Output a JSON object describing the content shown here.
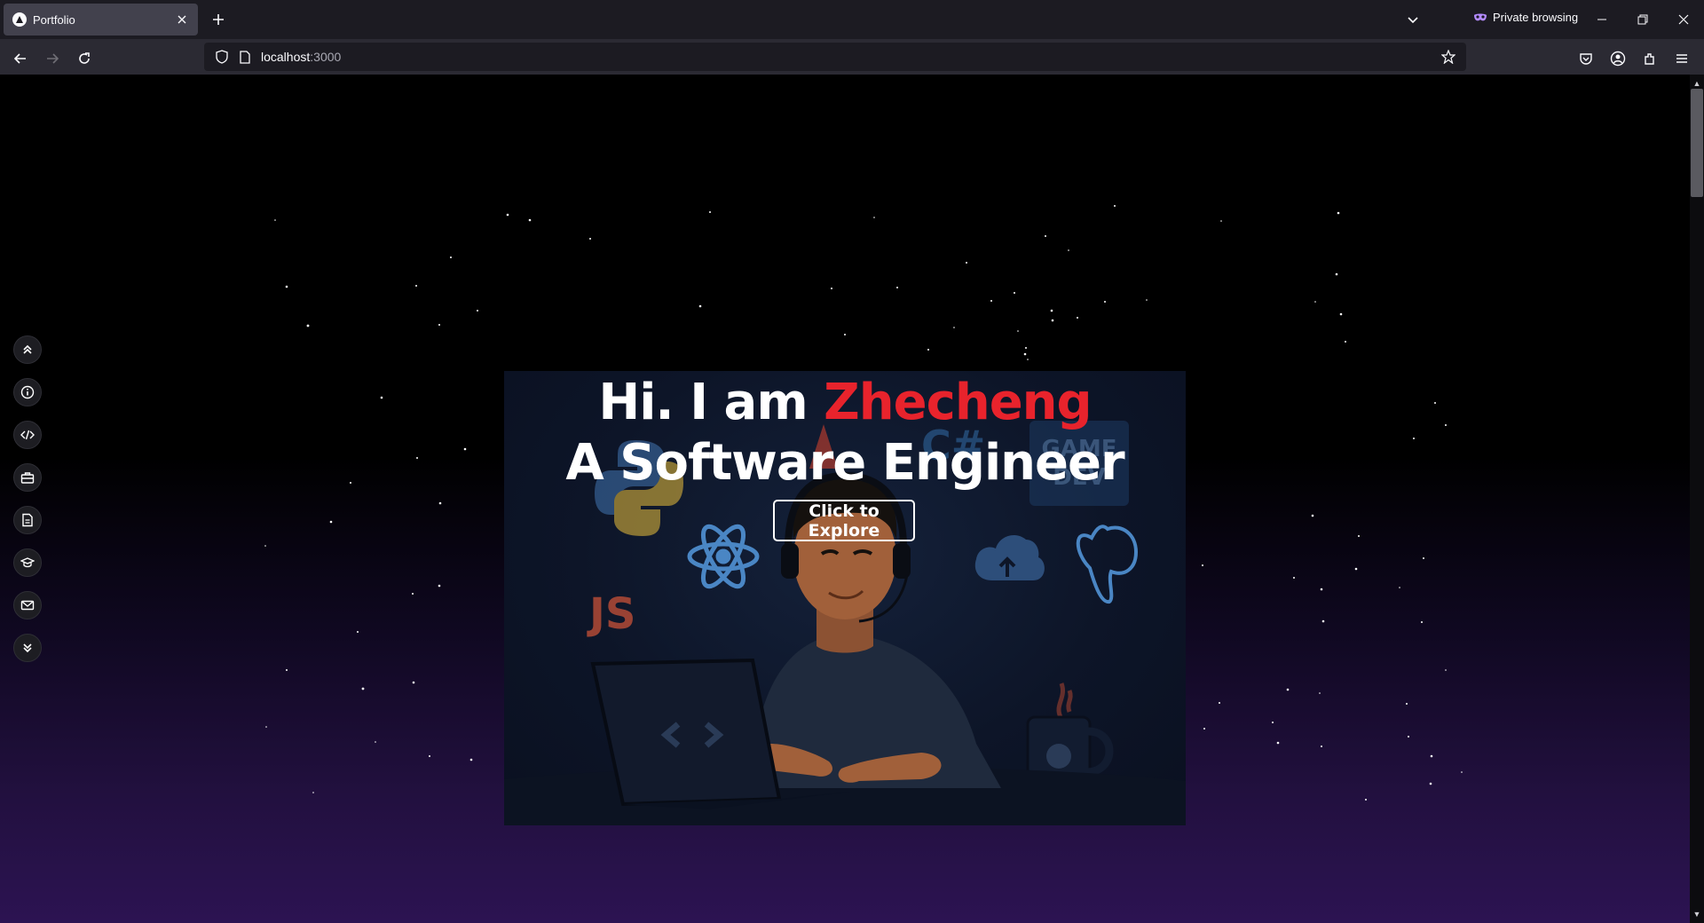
{
  "browser": {
    "tab_title": "Portfolio",
    "private_label": "Private browsing",
    "url_host": "localhost",
    "url_port": ":3000",
    "icons": [
      "favicon-icon",
      "close-icon",
      "plus-icon",
      "chevron-down-icon",
      "private-mask-icon",
      "minimize-icon",
      "restore-icon",
      "close-window-icon",
      "back-icon",
      "forward-icon",
      "reload-icon",
      "shield-icon",
      "page-icon",
      "star-icon",
      "pocket-icon",
      "account-icon",
      "extensions-icon",
      "menu-icon"
    ]
  },
  "sidebar": {
    "items": [
      {
        "icon": "chevrons-up-icon"
      },
      {
        "icon": "info-icon"
      },
      {
        "icon": "code-icon"
      },
      {
        "icon": "briefcase-icon"
      },
      {
        "icon": "document-icon"
      },
      {
        "icon": "graduation-cap-icon"
      },
      {
        "icon": "mail-icon"
      },
      {
        "icon": "chevrons-down-icon"
      }
    ]
  },
  "hero": {
    "greeting": "Hi. I am ",
    "name": "Zhecheng",
    "subtitle": "A Software Engineer",
    "cta_label": "Click to Explore",
    "name_color": "#e8232c",
    "illustration_labels": {
      "js": "JS",
      "csharp": "C#",
      "gamedev_line1": "GAME",
      "gamedev_line2": "DEV"
    }
  },
  "colors": {
    "chrome_dark": "#1c1b22",
    "chrome_mid": "#2b2a33",
    "tab_active": "#42414d",
    "page_bottom": "#2c1352"
  }
}
